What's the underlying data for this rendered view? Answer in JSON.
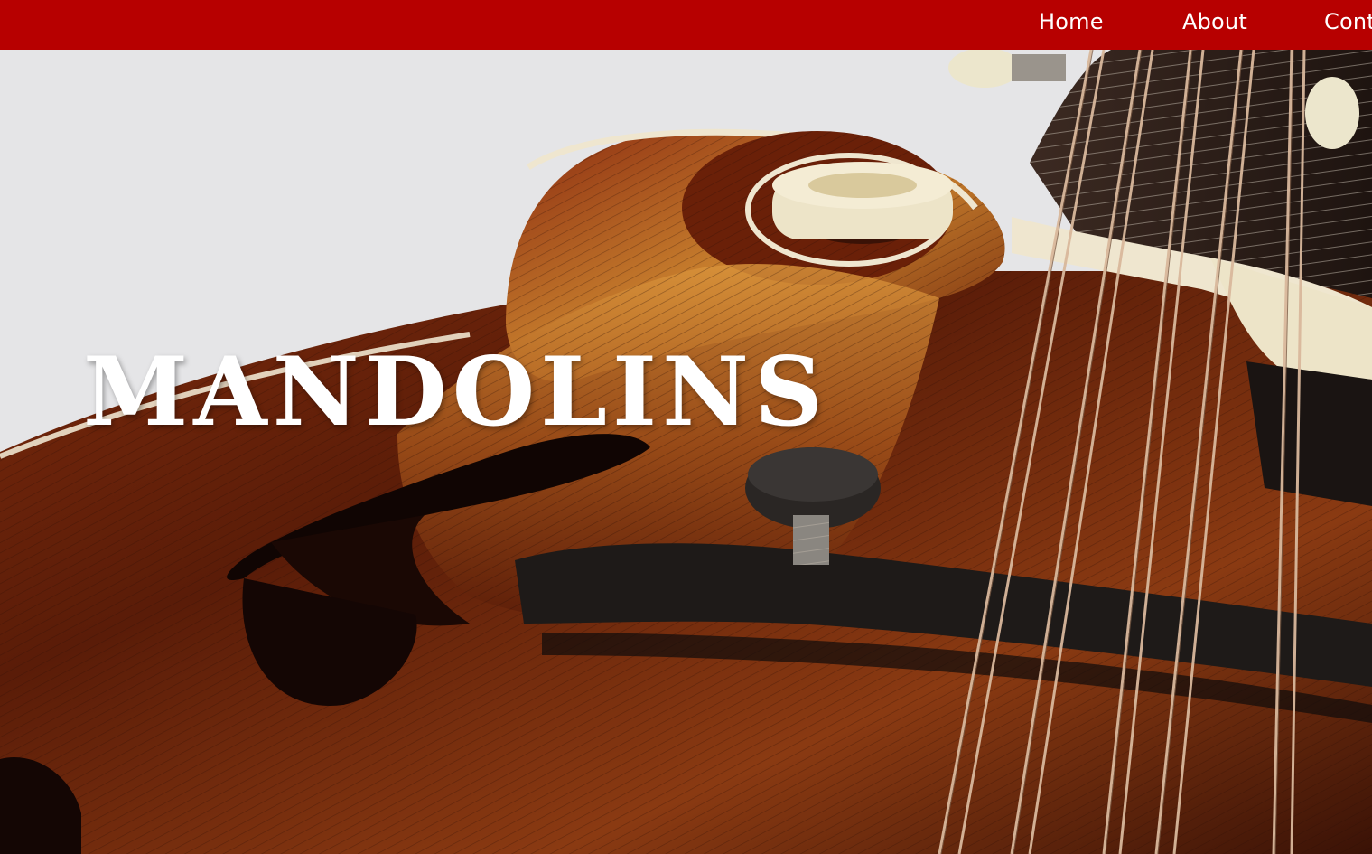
{
  "nav": {
    "items": [
      {
        "label": "Home"
      },
      {
        "label": "About"
      },
      {
        "label": "Cont"
      }
    ]
  },
  "hero": {
    "title": "mandolins",
    "image": "mandolin-closeup-photo"
  },
  "colors": {
    "navbar": "#b70000",
    "nav_text": "#ffffff",
    "title_text": "#ffffff",
    "wood_dark": "#3a1206",
    "wood_mid": "#7a2a0c",
    "wood_light": "#c9812e",
    "background": "#e9e9ea"
  }
}
